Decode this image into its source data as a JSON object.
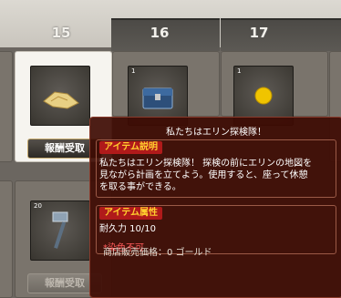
{
  "calendar": {
    "days": [
      "15",
      "16",
      "17"
    ],
    "claim_button_label": "報酬受取"
  },
  "slots": [
    {
      "day": "15",
      "icon": "treasure-map-icon",
      "count": ""
    },
    {
      "day": "16",
      "icon": "chest-icon",
      "count": "1"
    },
    {
      "day": "17",
      "icon": "gold-coin-icon",
      "count": "1"
    }
  ],
  "lower_slot": {
    "icon": "hammer-icon",
    "count": "20"
  },
  "tooltip": {
    "title": "私たちはエリン探検隊！",
    "desc_tag": "アイテム説明",
    "desc_lines": [
      "私たちはエリン探検隊！ 探検の前にエリンの地図を",
      "見ながら計画を立てよう。使用すると、座って休憩",
      "を取る事ができる。"
    ],
    "attr_tag": "アイテム属性",
    "durability": "耐久力 10/10",
    "no_dye": "*染色不可",
    "price": "商店販売価格：0 ゴールド"
  },
  "colors": {
    "tooltip_bg": "#3e0b03",
    "tag_bg": "#b01a1a",
    "tag_text": "#ffcf2e"
  }
}
